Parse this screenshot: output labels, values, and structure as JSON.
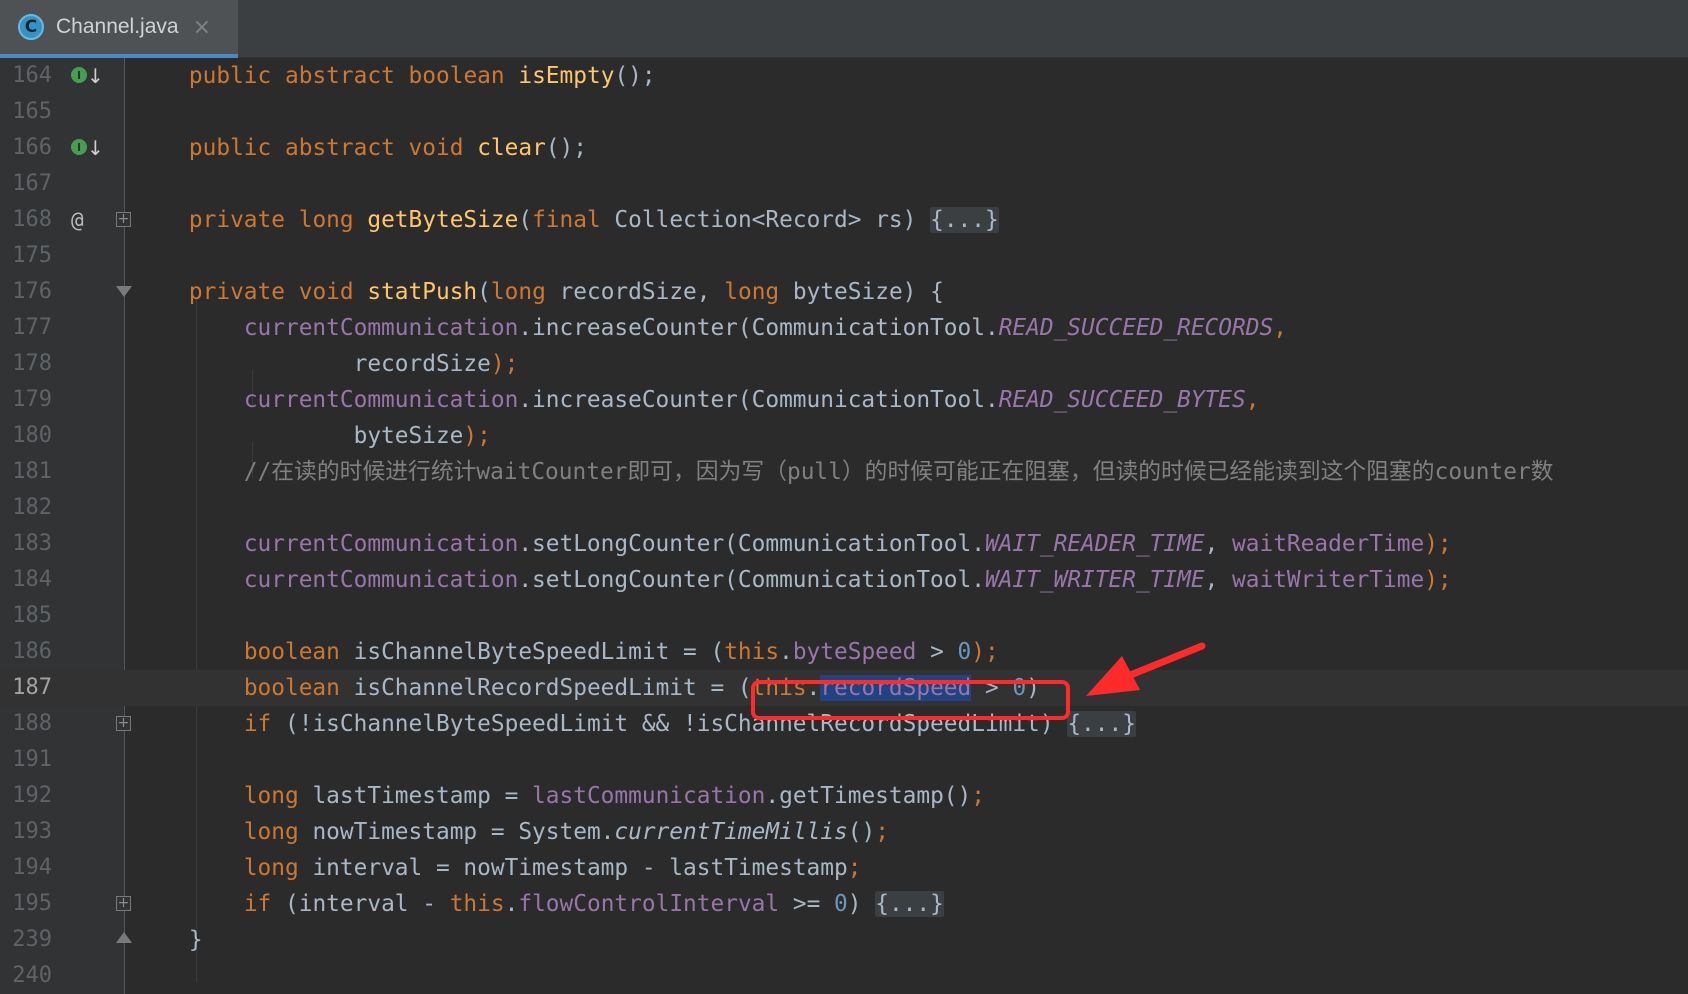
{
  "tab": {
    "icon": "class-c-icon",
    "icon_glyph": "C",
    "title": "Channel.java",
    "close": "×"
  },
  "lines": [
    {
      "n": "164",
      "icon": "implemented-down-icon"
    },
    {
      "n": "165"
    },
    {
      "n": "166",
      "icon": "implemented-down-icon"
    },
    {
      "n": "167"
    },
    {
      "n": "168",
      "icon": "at",
      "fold": "plus"
    },
    {
      "n": "175"
    },
    {
      "n": "176",
      "fold": "open"
    },
    {
      "n": "177"
    },
    {
      "n": "178"
    },
    {
      "n": "179"
    },
    {
      "n": "180"
    },
    {
      "n": "181"
    },
    {
      "n": "182"
    },
    {
      "n": "183"
    },
    {
      "n": "184"
    },
    {
      "n": "185"
    },
    {
      "n": "186"
    },
    {
      "n": "187",
      "current": true
    },
    {
      "n": "188",
      "fold": "plus"
    },
    {
      "n": "191"
    },
    {
      "n": "192"
    },
    {
      "n": "193"
    },
    {
      "n": "194"
    },
    {
      "n": "195",
      "fold": "plus"
    },
    {
      "n": "239",
      "fold": "end"
    },
    {
      "n": "240"
    }
  ],
  "gutter_at": "@",
  "implemented_glyph": "I",
  "implemented_arrow": "↓",
  "fold_plus": "+",
  "code": {
    "l164": [
      "    ",
      "public",
      " ",
      "abstract",
      " ",
      "boolean",
      " ",
      "isEmpty",
      "();"
    ],
    "l166": [
      "    ",
      "public",
      " ",
      "abstract",
      " ",
      "void",
      " ",
      "clear",
      "();"
    ],
    "l168": [
      "    ",
      "private",
      " ",
      "long",
      " ",
      "getByteSize",
      "(",
      "final",
      " Collection<Record> rs) ",
      "{...}"
    ],
    "l176": [
      "    ",
      "private",
      " ",
      "void",
      " ",
      "statPush",
      "(",
      "long",
      " recordSize, ",
      "long",
      " byteSize) {"
    ],
    "l177": [
      "        ",
      "currentCommunication",
      ".increaseCounter(CommunicationTool.",
      "READ_SUCCEED_RECORDS",
      ","
    ],
    "l178": [
      "                recordSize",
      ");"
    ],
    "l179": [
      "        ",
      "currentCommunication",
      ".increaseCounter(CommunicationTool.",
      "READ_SUCCEED_BYTES",
      ","
    ],
    "l180": [
      "                byteSize",
      ");"
    ],
    "l181": [
      "        ",
      "//在读的时候进行统计waitCounter即可，因为写（pull）的时候可能正在阻塞，但读的时候已经能读到这个阻塞的counter数"
    ],
    "l183": [
      "        ",
      "currentCommunication",
      ".setLongCounter(CommunicationTool.",
      "WAIT_READER_TIME",
      ", ",
      "waitReaderTime",
      ");"
    ],
    "l184": [
      "        ",
      "currentCommunication",
      ".setLongCounter(CommunicationTool.",
      "WAIT_WRITER_TIME",
      ", ",
      "waitWriterTime",
      ");"
    ],
    "l186": [
      "        ",
      "boolean",
      " isChannelByteSpeedLimit = (",
      "this",
      ".",
      "byteSpeed",
      " > ",
      "0",
      ");"
    ],
    "l187": [
      "        ",
      "boolean",
      " isChannelRecordSpeedLimit = (",
      "this",
      ".",
      "recordSpeed",
      " > ",
      "0",
      ")"
    ],
    "l188": [
      "        ",
      "if",
      " (!isChannelByteSpeedLimit && !isChannelRecordSpeedLimit) ",
      "{...}"
    ],
    "l192": [
      "        ",
      "long",
      " lastTimestamp = ",
      "lastCommunication",
      ".getTimestamp()",
      ";"
    ],
    "l193": [
      "        ",
      "long",
      " nowTimestamp = System.",
      "currentTimeMillis",
      "()",
      ";"
    ],
    "l194": [
      "        ",
      "long",
      " interval = nowTimestamp - lastTimestamp",
      ";"
    ],
    "l195": [
      "        ",
      "if",
      " (interval - ",
      "this",
      ".",
      "flowControlInterval",
      " >= ",
      "0",
      ") ",
      "{...}"
    ],
    "l239": [
      "    }"
    ]
  },
  "colors": {
    "background": "#2b2b2b",
    "gutter": "#313335",
    "keyword": "#cc7832",
    "method": "#ffc66d",
    "field": "#9876aa",
    "number": "#6897bb",
    "comment": "#808080",
    "text": "#a9b7c6",
    "selection": "#214283",
    "annotation": "#ff2a2a"
  }
}
